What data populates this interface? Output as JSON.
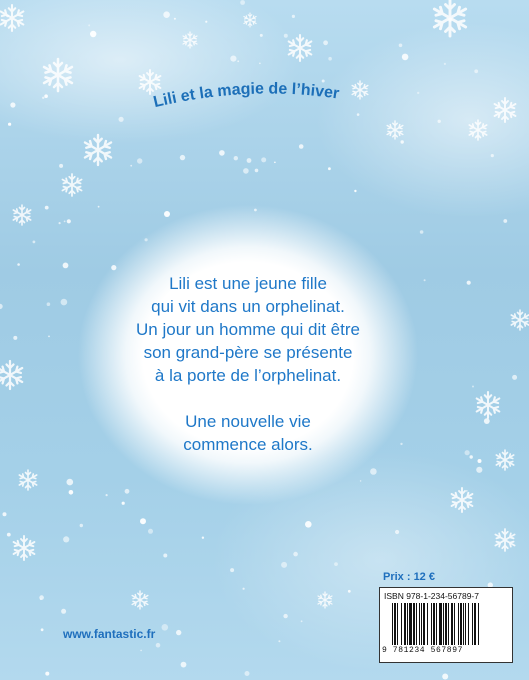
{
  "cover": {
    "title": "Lili et la magie de l’hiver",
    "blurb_paragraphs": [
      [
        "Lili est une jeune fille",
        "qui vit dans un orphelinat.",
        "Un jour un homme qui dit être",
        "son grand-père se présente",
        "à la porte de l’orphelinat."
      ],
      [
        "Une nouvelle vie",
        "commence alors."
      ]
    ],
    "price": "Prix : 12 €",
    "isbn": "ISBN 978-1-234-56789-7",
    "barcode_digits": "9 781234 567897",
    "website": "www.fantastic.fr",
    "colors": {
      "title": "#1c6fb8",
      "text": "#1f78c8",
      "background": "#a9d4ea"
    },
    "icons": [
      "snowflake-icon",
      "barcode"
    ]
  }
}
